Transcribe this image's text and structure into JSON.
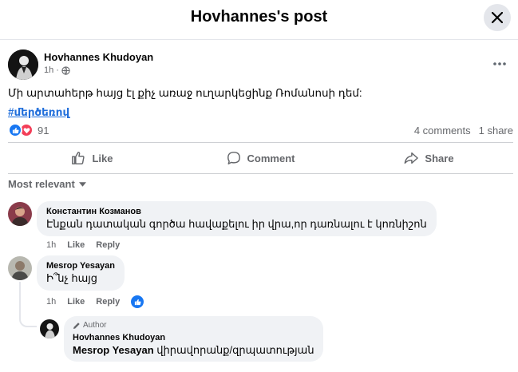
{
  "header": {
    "title": "Hovhannes's post"
  },
  "post": {
    "author": "Hovhannes Khudoyan",
    "time": "1h",
    "separator": "·",
    "text": "Մի արտահերթ հայց էլ քիչ առաջ ուղարկեցինք Ռոմանոսի դեմ:",
    "hashtag": "#մերծեռով",
    "reaction_count": "91",
    "comments_count": "4 comments",
    "shares_count": "1 share"
  },
  "actions": {
    "like": "Like",
    "comment": "Comment",
    "share": "Share"
  },
  "sort": {
    "label": "Most relevant"
  },
  "comments": [
    {
      "name": "Константин Козманов",
      "text": "Էնքան դատական գործա հավաքելու իր վրա,որ դառնալու է կոռնիշոն",
      "time": "1h",
      "like": "Like",
      "reply": "Reply"
    },
    {
      "name": "Mesrop Yesayan",
      "text": "Ի՞նչ հայց",
      "time": "1h",
      "like": "Like",
      "reply": "Reply"
    }
  ],
  "reply": {
    "tag": "Author",
    "name": "Hovhannes Khudoyan",
    "mention": "Mesrop Yesayan",
    "text": "վիրավորանք/զրպատության"
  },
  "colors": {
    "accent": "#1877f2",
    "love": "#f33e58",
    "link": "#216fdb"
  }
}
